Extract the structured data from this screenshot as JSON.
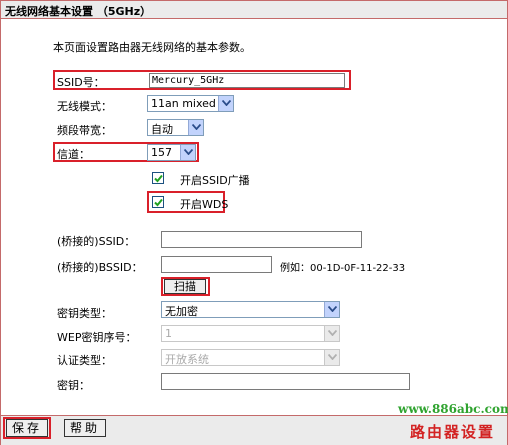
{
  "page": {
    "title": "无线网络基本设置 （5GHz）",
    "intro": "本页面设置路由器无线网络的基本参数。"
  },
  "form": {
    "ssid": {
      "label": "SSID号：",
      "value": "Mercury_5GHz"
    },
    "mode": {
      "label": "无线模式：",
      "value": "11an mixed"
    },
    "bandwidth": {
      "label": "频段带宽：",
      "value": "自动"
    },
    "channel": {
      "label": "信道：",
      "value": "157"
    },
    "ssid_broadcast": {
      "label": "开启SSID广播",
      "checked": true
    },
    "wds": {
      "label": "开启WDS",
      "checked": true
    },
    "bridge_ssid": {
      "label": "(桥接的)SSID：",
      "value": ""
    },
    "bridge_bssid": {
      "label": "(桥接的)BSSID：",
      "value": "",
      "example": "例如：00-1D-0F-11-22-33"
    },
    "scan_label": "扫描",
    "key_type": {
      "label": "密钥类型：",
      "value": "无加密"
    },
    "wep_index": {
      "label": "WEP密钥序号：",
      "value": "1"
    },
    "auth_type": {
      "label": "认证类型：",
      "value": "开放系统"
    },
    "key": {
      "label": "密钥：",
      "value": ""
    }
  },
  "buttons": {
    "save": "保存",
    "help": "帮助"
  },
  "watermark": {
    "url": "www.886abc.com",
    "text": "路由器设置"
  },
  "colors": {
    "highlight": "#d9202a",
    "frame": "#c46a6a",
    "bar": "#ebebeb",
    "watermark_url": "#2fa32f",
    "watermark_text": "#d32323"
  }
}
